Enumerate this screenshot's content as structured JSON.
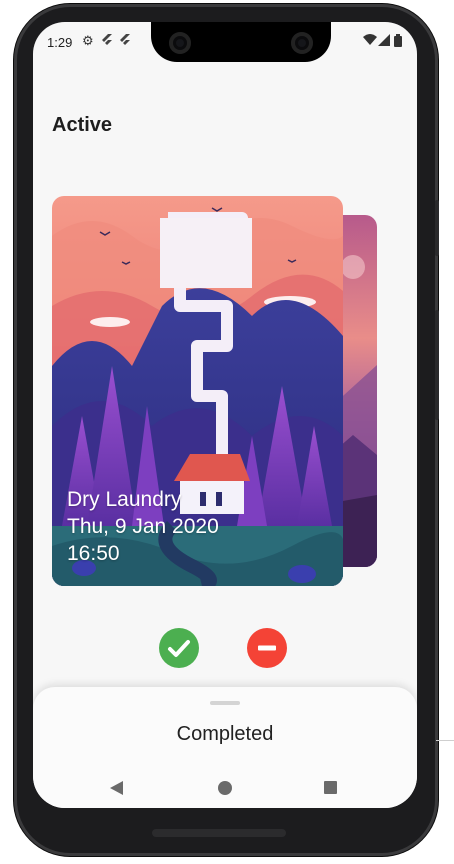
{
  "status_bar": {
    "time": "1:29",
    "icons": [
      "settings-icon",
      "flutter-icon",
      "flutter-icon",
      "wifi-icon",
      "signal-icon",
      "battery-icon"
    ]
  },
  "page": {
    "title": "Active"
  },
  "active_card": {
    "task": "Dry Laundry",
    "date": "Thu, 9 Jan 2020",
    "time": "16:50"
  },
  "actions": {
    "complete": {
      "icon": "check-icon",
      "color": "#4caf50"
    },
    "remove": {
      "icon": "minus-icon",
      "color": "#f44336"
    }
  },
  "bottom_sheet": {
    "title": "Completed"
  },
  "nav": [
    "back-icon",
    "home-icon",
    "recents-icon"
  ]
}
